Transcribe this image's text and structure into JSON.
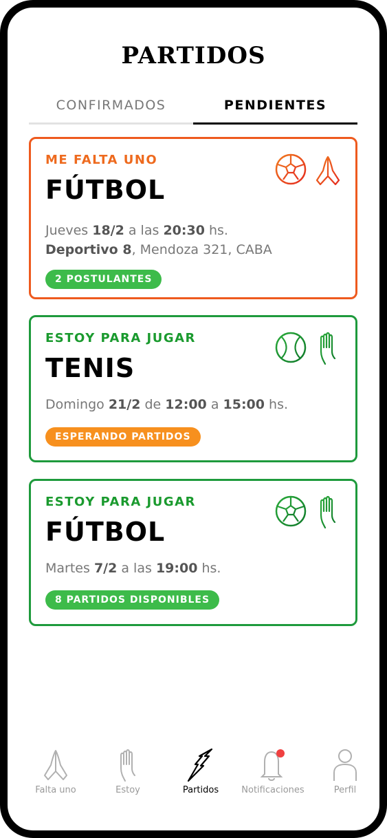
{
  "title": "PARTIDOS",
  "tabs": {
    "confirmed": "CONFIRMADOS",
    "pending": "PENDIENTES"
  },
  "colors": {
    "green": "#1e9a3c",
    "orange": "#ee5a1e",
    "badge_green": "#3dbb4a",
    "badge_orange": "#f7901e",
    "notification_dot": "#f04040"
  },
  "cards": [
    {
      "type": "ME FALTA UNO",
      "sport": "FÚTBOL",
      "day": "Jueves",
      "date": "18/2",
      "a_las": "a las",
      "time": "20:30",
      "hs": "hs.",
      "venue": "Deportivo 8",
      "address": ", Mendoza 321, CABA",
      "badge": "2 POSTULANTES",
      "icons": [
        "soccer-ball-icon",
        "praying-hands-icon"
      ]
    },
    {
      "type": "ESTOY PARA JUGAR",
      "sport": "TENIS",
      "day": "Domingo",
      "date": "21/2",
      "de": "de",
      "time_start": "12:00",
      "a": "a",
      "time_end": "15:00",
      "hs": "hs.",
      "badge": "ESPERANDO PARTIDOS",
      "icons": [
        "tennis-ball-icon",
        "raised-hand-icon"
      ]
    },
    {
      "type": "ESTOY PARA JUGAR",
      "sport": "FÚTBOL",
      "day": "Martes",
      "date": "7/2",
      "a_las": "a las",
      "time": "19:00",
      "hs": "hs.",
      "badge": "8 PARTIDOS DISPONIBLES",
      "icons": [
        "soccer-ball-icon",
        "raised-hand-icon"
      ]
    }
  ],
  "nav": [
    {
      "label": "Falta uno",
      "icon": "praying-hands-icon"
    },
    {
      "label": "Estoy",
      "icon": "raised-hand-icon"
    },
    {
      "label": "Partidos",
      "icon": "lightning-icon",
      "active": true
    },
    {
      "label": "Notificaciones",
      "icon": "bell-icon"
    },
    {
      "label": "Perfil",
      "icon": "user-icon"
    }
  ]
}
